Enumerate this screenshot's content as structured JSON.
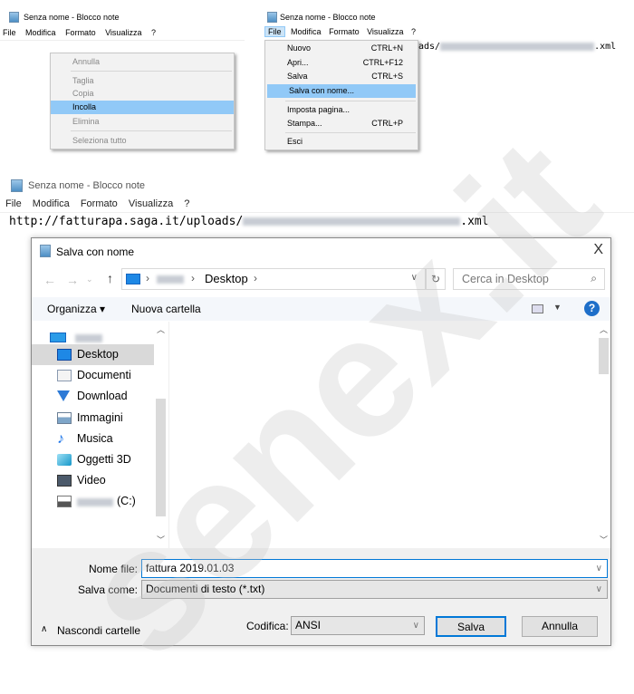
{
  "notepad1": {
    "title": "Senza nome - Blocco note",
    "menu": [
      "File",
      "Modifica",
      "Formato",
      "Visualizza",
      "?"
    ],
    "context_menu": [
      {
        "label": "Annulla",
        "disabled": true
      },
      {
        "label": "Taglia",
        "disabled": true
      },
      {
        "label": "Copia",
        "disabled": true
      },
      {
        "label": "Incolla",
        "highlighted": true
      },
      {
        "label": "Elimina",
        "disabled": true
      },
      {
        "label": "Seleziona tutto",
        "disabled": true
      }
    ]
  },
  "notepad2": {
    "title": "Senza nome - Blocco note",
    "menu": [
      "File",
      "Modifica",
      "Formato",
      "Visualizza",
      "?"
    ],
    "active_menu": "File",
    "text_prefix": "ads/",
    "text_suffix": ".xml",
    "file_menu": [
      {
        "label": "Nuovo",
        "shortcut": "CTRL+N"
      },
      {
        "label": "Apri...",
        "shortcut": "CTRL+F12"
      },
      {
        "label": "Salva",
        "shortcut": "CTRL+S"
      },
      {
        "label": "Salva con nome...",
        "shortcut": "",
        "highlighted": true
      },
      {
        "label": "Imposta pagina...",
        "shortcut": ""
      },
      {
        "label": "Stampa...",
        "shortcut": "CTRL+P"
      },
      {
        "label": "Esci",
        "shortcut": ""
      }
    ]
  },
  "notepad3": {
    "title": "Senza nome - Blocco note",
    "menu": [
      "File",
      "Modifica",
      "Formato",
      "Visualizza",
      "?"
    ],
    "url_prefix": "http://fatturapa.saga.it/uploads/",
    "url_suffix": ".xml"
  },
  "dialog": {
    "title": "Salva con nome",
    "close": "X",
    "breadcrumb_current": "Desktop",
    "search_placeholder": "Cerca in Desktop",
    "organize": "Organizza ▾",
    "new_folder": "Nuova cartella",
    "nav_items": [
      {
        "label": "Desktop",
        "icon": "desktop-icon",
        "selected": true
      },
      {
        "label": "Documenti",
        "icon": "documents-icon"
      },
      {
        "label": "Download",
        "icon": "download-icon"
      },
      {
        "label": "Immagini",
        "icon": "pictures-icon"
      },
      {
        "label": "Musica",
        "icon": "music-icon"
      },
      {
        "label": "Oggetti 3D",
        "icon": "3d-objects-icon"
      },
      {
        "label": "Video",
        "icon": "video-icon"
      },
      {
        "label": "(C:)",
        "icon": "drive-icon"
      }
    ],
    "filename_label": "Nome file:",
    "filename_value": "fattura 2019.01.03",
    "savetype_label": "Salva come:",
    "savetype_value": "Documenti di testo (*.txt)",
    "hide_folders": "Nascondi cartelle",
    "encoding_label": "Codifica:",
    "encoding_value": "ANSI",
    "save": "Salva",
    "cancel": "Annulla"
  },
  "watermark": "senex.it",
  "colors": {
    "highlight": "#91c9f7",
    "selected": "#d9d9d9",
    "accent": "#0078d7"
  }
}
